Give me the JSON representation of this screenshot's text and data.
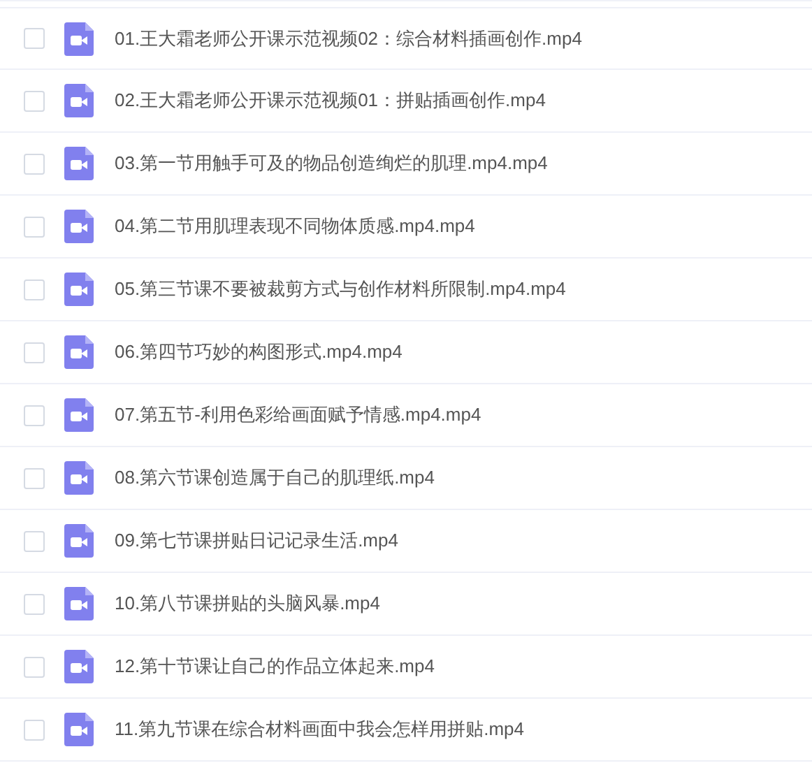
{
  "files": [
    {
      "name": "01.王大霜老师公开课示范视频02：综合材料插画创作.mp4",
      "checked": false
    },
    {
      "name": "02.王大霜老师公开课示范视频01：拼贴插画创作.mp4",
      "checked": false
    },
    {
      "name": "03.第一节用触手可及的物品创造绚烂的肌理.mp4.mp4",
      "checked": false
    },
    {
      "name": "04.第二节用肌理表现不同物体质感.mp4.mp4",
      "checked": false
    },
    {
      "name": "05.第三节课不要被裁剪方式与创作材料所限制.mp4.mp4",
      "checked": false
    },
    {
      "name": "06.第四节巧妙的构图形式.mp4.mp4",
      "checked": false
    },
    {
      "name": "07.第五节-利用色彩给画面赋予情感.mp4.mp4",
      "checked": false
    },
    {
      "name": "08.第六节课创造属于自己的肌理纸.mp4",
      "checked": false
    },
    {
      "name": "09.第七节课拼贴日记记录生活.mp4",
      "checked": false
    },
    {
      "name": "10.第八节课拼贴的头脑风暴.mp4",
      "checked": false
    },
    {
      "name": "12.第十节课让自己的作品立体起来.mp4",
      "checked": false
    },
    {
      "name": "11.第九节课在综合材料画面中我会怎样用拼贴.mp4",
      "checked": false
    }
  ]
}
